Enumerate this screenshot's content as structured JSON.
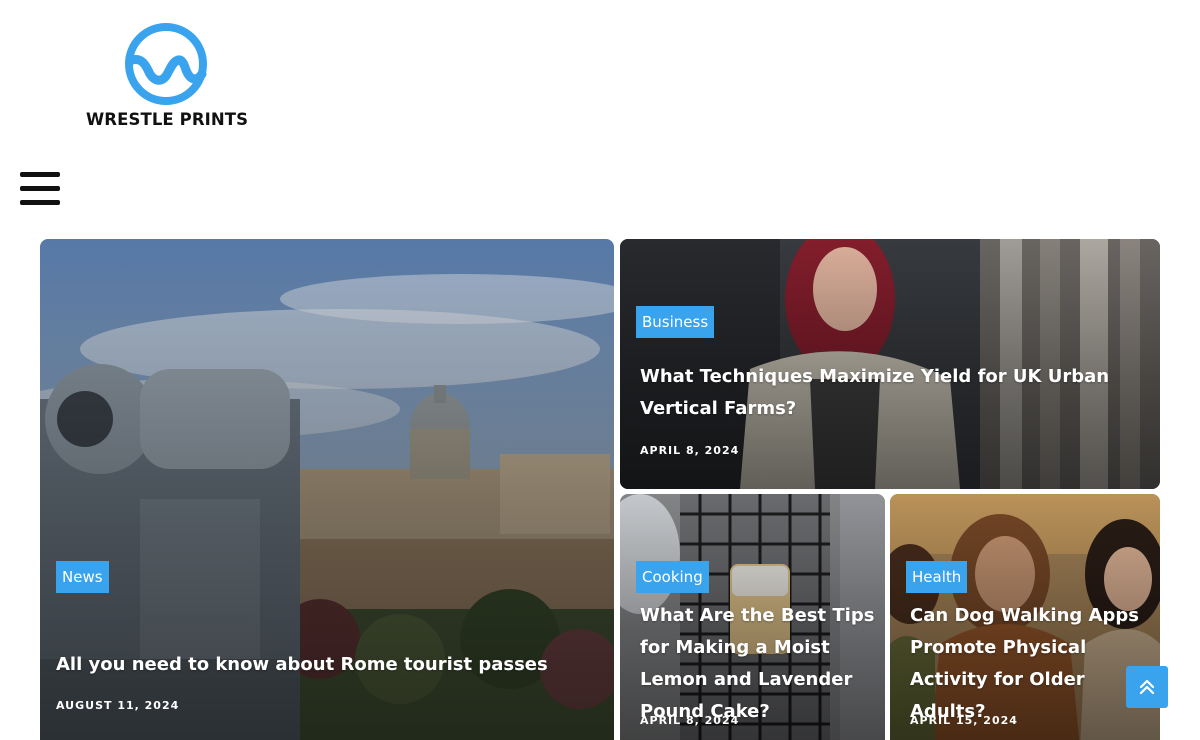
{
  "brand": {
    "name": "WRESTLE PRINTS",
    "color": "#3aa3ee"
  },
  "nav": {
    "menu_icon": "hamburger-menu-icon"
  },
  "featured": {
    "main": {
      "category": "News",
      "title": "All you need to know about Rome tourist passes",
      "date": "AUGUST 11, 2024"
    },
    "top_right": {
      "category": "Business",
      "title": "What Techniques Maximize Yield for UK Urban Vertical Farms?",
      "date": "APRIL 8, 2024"
    },
    "bottom_left": {
      "category": "Cooking",
      "title": "What Are the Best Tips for Making a Moist Lemon and Lavender Pound Cake?",
      "date": "APRIL 8, 2024"
    },
    "bottom_right": {
      "category": "Health",
      "title": "Can Dog Walking Apps Promote Physical Activity for Older Adults?",
      "date": "APRIL 15, 2024"
    }
  },
  "scroll_top": {
    "icon": "double-chevron-up-icon"
  },
  "colors": {
    "accent": "#3aa3ee",
    "text_dark": "#111111"
  }
}
